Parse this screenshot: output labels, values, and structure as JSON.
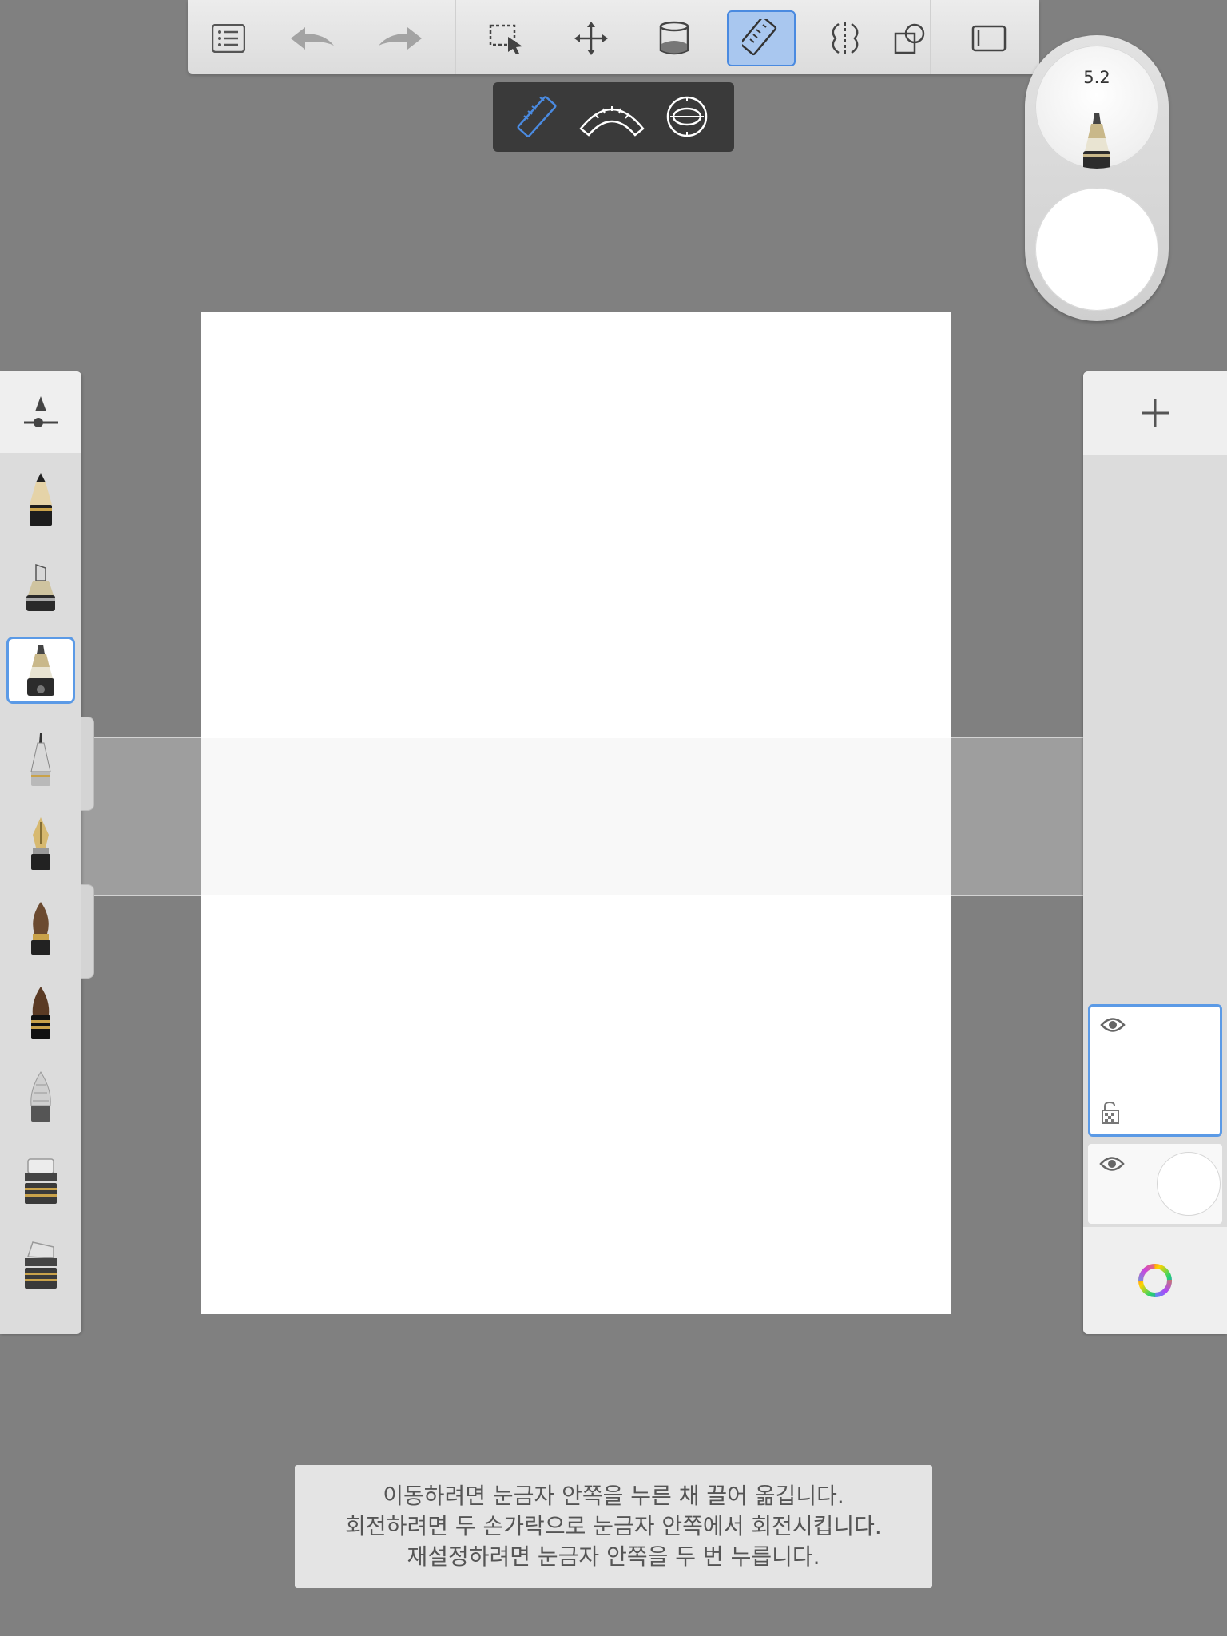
{
  "toolbar": {
    "buttons": [
      {
        "name": "layers-list",
        "icon": "list-icon"
      },
      {
        "name": "undo",
        "icon": "undo-icon"
      },
      {
        "name": "redo",
        "icon": "redo-icon"
      },
      {
        "name": "selection",
        "icon": "selection-icon"
      },
      {
        "name": "transform",
        "icon": "move-icon"
      },
      {
        "name": "fill",
        "icon": "paint-bucket-icon"
      },
      {
        "name": "ruler",
        "icon": "ruler-icon",
        "active": true
      },
      {
        "name": "symmetry",
        "icon": "symmetry-icon"
      },
      {
        "name": "shapes",
        "icon": "shape-icon"
      },
      {
        "name": "fullscreen",
        "icon": "frame-icon"
      }
    ]
  },
  "ruler_menu": {
    "items": [
      {
        "name": "straight-ruler",
        "icon": "straight-ruler-icon",
        "active": true
      },
      {
        "name": "french-curve",
        "icon": "french-curve-icon"
      },
      {
        "name": "ellipse-guide",
        "icon": "ellipse-guide-icon"
      }
    ]
  },
  "brush_puck": {
    "size": "5.2",
    "color": "#ffffff"
  },
  "brushes": [
    {
      "name": "pencil",
      "icon": "pencil-brush-icon"
    },
    {
      "name": "marker",
      "icon": "marker-brush-icon"
    },
    {
      "name": "ballpoint",
      "icon": "ballpoint-brush-icon",
      "active": true
    },
    {
      "name": "airbrush",
      "icon": "airbrush-brush-icon"
    },
    {
      "name": "fountain-pen",
      "icon": "fountain-pen-brush-icon"
    },
    {
      "name": "paint-brush",
      "icon": "paint-brush-icon"
    },
    {
      "name": "ink-brush",
      "icon": "ink-brush-icon"
    },
    {
      "name": "smudge",
      "icon": "smudge-brush-icon"
    },
    {
      "name": "eraser-hard",
      "icon": "eraser-hard-icon"
    },
    {
      "name": "eraser-soft",
      "icon": "eraser-soft-icon"
    }
  ],
  "layers": {
    "add_icon": "plus-icon",
    "items": [
      {
        "name": "layer-1",
        "active": true,
        "visible": true
      },
      {
        "name": "background",
        "visible": true
      }
    ]
  },
  "hint": {
    "line1": "이동하려면 눈금자 안쪽을 누른 채 끌어 옮깁니다.",
    "line2": "회전하려면 두 손가락으로 눈금자 안쪽에서 회전시킵니다.",
    "line3": "재설정하려면 눈금자 안쪽을 두 번 누릅니다."
  },
  "colors": {
    "background": "#808080",
    "accent": "#4a8ae0",
    "active_fill": "#a9c7ef"
  }
}
